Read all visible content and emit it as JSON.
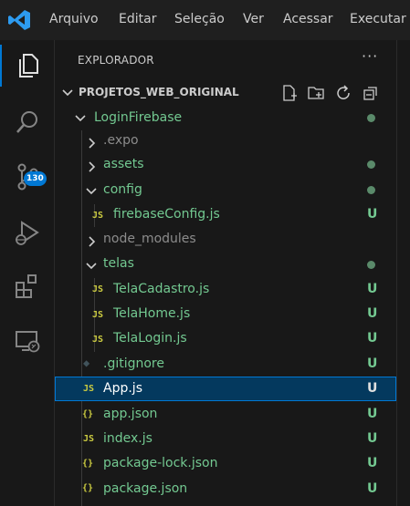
{
  "menu": [
    "Arquivo",
    "Editar",
    "Seleção",
    "Ver",
    "Acessar",
    "Executar"
  ],
  "activity": {
    "source_control_badge": "130"
  },
  "explorer": {
    "title": "EXPLORADOR",
    "more": "···",
    "root": "PROJETOS_WEB_ORIGINAL",
    "items": [
      {
        "label": "LoginFirebase",
        "type": "folder",
        "expanded": true
      },
      {
        "label": ".expo",
        "type": "folder",
        "expanded": false
      },
      {
        "label": "assets",
        "type": "folder",
        "expanded": false
      },
      {
        "label": "config",
        "type": "folder",
        "expanded": true
      },
      {
        "label": "firebaseConfig.js",
        "type": "js",
        "icon": "JS",
        "status": "U"
      },
      {
        "label": "node_modules",
        "type": "folder",
        "expanded": false
      },
      {
        "label": "telas",
        "type": "folder",
        "expanded": true
      },
      {
        "label": "TelaCadastro.js",
        "type": "js",
        "icon": "JS",
        "status": "U"
      },
      {
        "label": "TelaHome.js",
        "type": "js",
        "icon": "JS",
        "status": "U"
      },
      {
        "label": "TelaLogin.js",
        "type": "js",
        "icon": "JS",
        "status": "U"
      },
      {
        "label": ".gitignore",
        "type": "git",
        "icon": "◆",
        "status": "U"
      },
      {
        "label": "App.js",
        "type": "js",
        "icon": "JS",
        "status": "U"
      },
      {
        "label": "app.json",
        "type": "json",
        "icon": "{}",
        "status": "U"
      },
      {
        "label": "index.js",
        "type": "js",
        "icon": "JS",
        "status": "U"
      },
      {
        "label": "package-lock.json",
        "type": "json",
        "icon": "{}",
        "status": "U"
      },
      {
        "label": "package.json",
        "type": "json",
        "icon": "{}",
        "status": "U"
      }
    ]
  },
  "colors": {
    "accent": "#0078d4",
    "untracked": "#73c991",
    "js_icon": "#cbcb41",
    "selection": "#04395e"
  }
}
